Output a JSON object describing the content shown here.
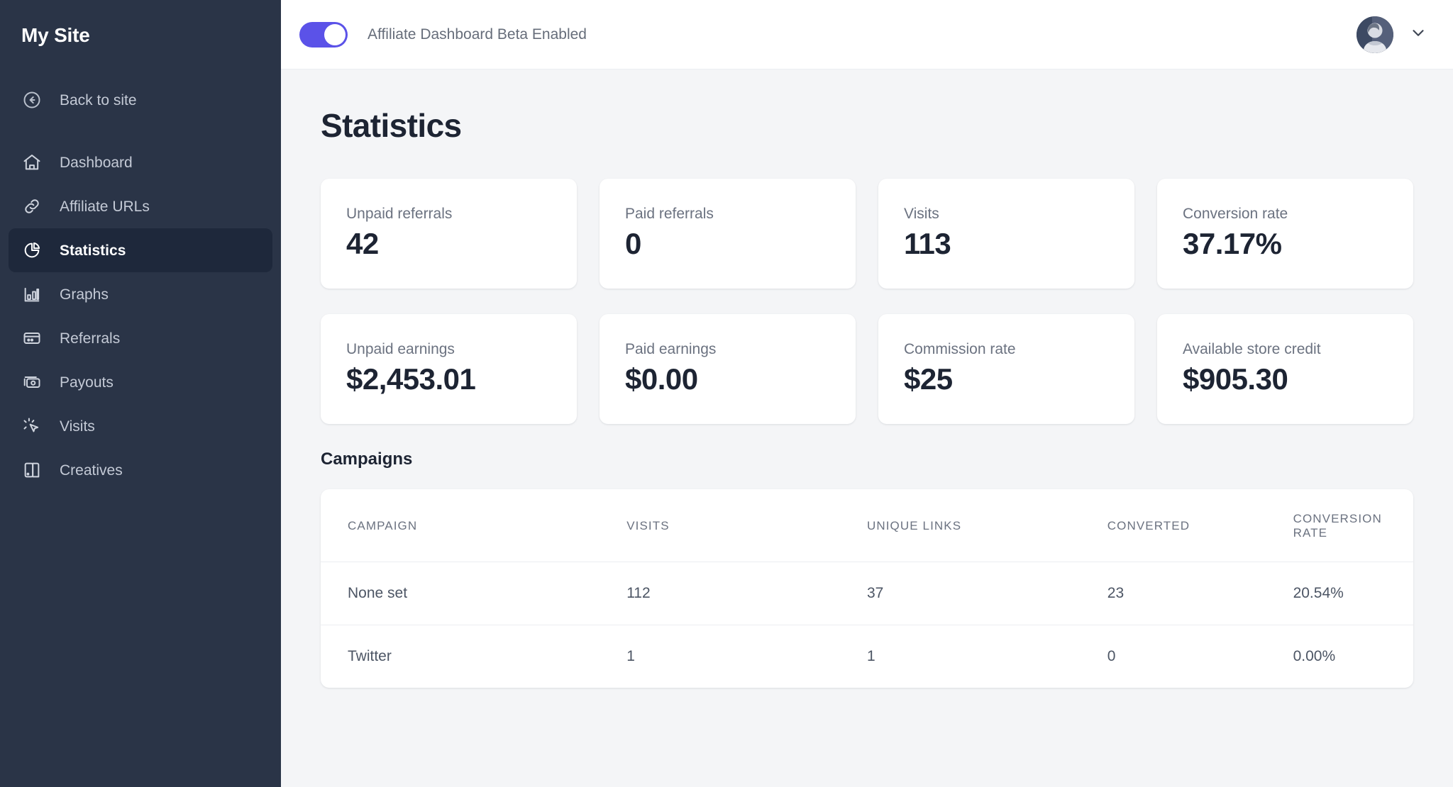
{
  "sidebar": {
    "site_title": "My Site",
    "back_link": {
      "label": "Back to site",
      "icon": "arrow-left-circle-icon"
    },
    "items": [
      {
        "label": "Dashboard",
        "icon": "home-icon",
        "active": false
      },
      {
        "label": "Affiliate URLs",
        "icon": "link-icon",
        "active": false
      },
      {
        "label": "Statistics",
        "icon": "pie-chart-icon",
        "active": true
      },
      {
        "label": "Graphs",
        "icon": "bar-chart-icon",
        "active": false
      },
      {
        "label": "Referrals",
        "icon": "card-icon",
        "active": false
      },
      {
        "label": "Payouts",
        "icon": "money-icon",
        "active": false
      },
      {
        "label": "Visits",
        "icon": "cursor-click-icon",
        "active": false
      },
      {
        "label": "Creatives",
        "icon": "creatives-icon",
        "active": false
      }
    ],
    "bg_color": "#2a3447",
    "active_bg_color": "#1e283b"
  },
  "topbar": {
    "toggle": {
      "label": "Affiliate Dashboard Beta Enabled",
      "enabled": true,
      "on_color": "#5b52e8"
    },
    "avatar_name": "user-avatar",
    "chevron_icon": "chevron-down-icon"
  },
  "page": {
    "title": "Statistics"
  },
  "stats": {
    "row1": [
      {
        "label": "Unpaid referrals",
        "value": "42"
      },
      {
        "label": "Paid referrals",
        "value": "0"
      },
      {
        "label": "Visits",
        "value": "113"
      },
      {
        "label": "Conversion rate",
        "value": "37.17%"
      }
    ],
    "row2": [
      {
        "label": "Unpaid earnings",
        "value": "$2,453.01"
      },
      {
        "label": "Paid earnings",
        "value": "$0.00"
      },
      {
        "label": "Commission rate",
        "value": "$25"
      },
      {
        "label": "Available store credit",
        "value": "$905.30"
      }
    ]
  },
  "campaigns": {
    "section_title": "Campaigns",
    "columns": [
      "CAMPAIGN",
      "VISITS",
      "UNIQUE LINKS",
      "CONVERTED",
      "CONVERSION RATE"
    ],
    "rows": [
      {
        "campaign": "None set",
        "visits": "112",
        "unique_links": "37",
        "converted": "23",
        "conversion_rate": "20.54%"
      },
      {
        "campaign": "Twitter",
        "visits": "1",
        "unique_links": "1",
        "converted": "0",
        "conversion_rate": "0.00%"
      }
    ]
  }
}
